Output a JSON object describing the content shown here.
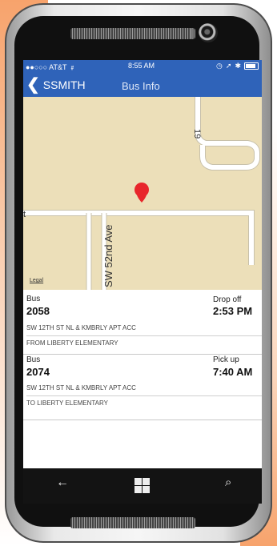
{
  "status": {
    "carrier": "●●○○○ AT&T",
    "time": "8:55 AM"
  },
  "nav": {
    "back_label": "SSMITH",
    "title": "Bus Info"
  },
  "map": {
    "street_label": "SW 52nd Ave",
    "corner_label": "19",
    "left_label": "t",
    "legal": "Legal"
  },
  "trips": [
    {
      "bus_label": "Bus",
      "bus_number": "2058",
      "time_label": "Drop off",
      "time": "2:53 PM",
      "stop": "SW 12TH ST NL & KMBRLY APT ACC",
      "direction": "FROM LIBERTY ELEMENTARY"
    },
    {
      "bus_label": "Bus",
      "bus_number": "2074",
      "time_label": "Pick up",
      "time": "7:40 AM",
      "stop": "SW 12TH ST NL & KMBRLY APT ACC",
      "direction": "TO LIBERTY ELEMENTARY"
    }
  ],
  "colors": {
    "nav_blue": "#2f63b9",
    "map_bg": "#ecdfb9",
    "pin_red": "#e8262b"
  },
  "icons": [
    "wifi-icon",
    "alarm-icon",
    "location-icon",
    "bluetooth-icon",
    "battery-icon",
    "back-arrow-icon",
    "windows-icon",
    "search-icon",
    "map-pin-icon"
  ]
}
